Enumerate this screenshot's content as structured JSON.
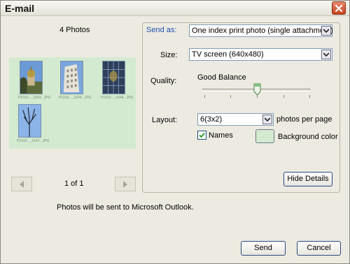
{
  "window": {
    "title": "E-mail"
  },
  "left": {
    "photo_count": "4 Photos",
    "page_indicator": "1 of 1",
    "thumbnails": [
      {
        "caption": "P1010..._1643...JPG"
      },
      {
        "caption": "P1010..._1645...JPG"
      },
      {
        "caption": "P1010..._1644...JPG"
      },
      {
        "caption": "P1010..._1647...JPG"
      }
    ]
  },
  "status": {
    "text": "Photos will be sent to Microsoft Outlook."
  },
  "options": {
    "send_as_label": "Send as:",
    "send_as_value": "One index print photo (single attachment)",
    "size_label": "Size:",
    "size_value": "TV screen (640x480)",
    "quality_label": "Quality:",
    "quality_value": "Good Balance",
    "layout_label": "Layout:",
    "layout_value": "6(3x2)",
    "layout_suffix": "photos per page",
    "names_label": "Names",
    "names_checked": true,
    "background_label": "Background color",
    "background_color": "#d3ead0",
    "hide_details_label": "Hide Details"
  },
  "buttons": {
    "send_label": "Send",
    "cancel_label": "Cancel"
  },
  "colors": {
    "link_blue": "#1f4fb4",
    "close_red": "#c7421c",
    "button_border": "#2a4a83"
  }
}
